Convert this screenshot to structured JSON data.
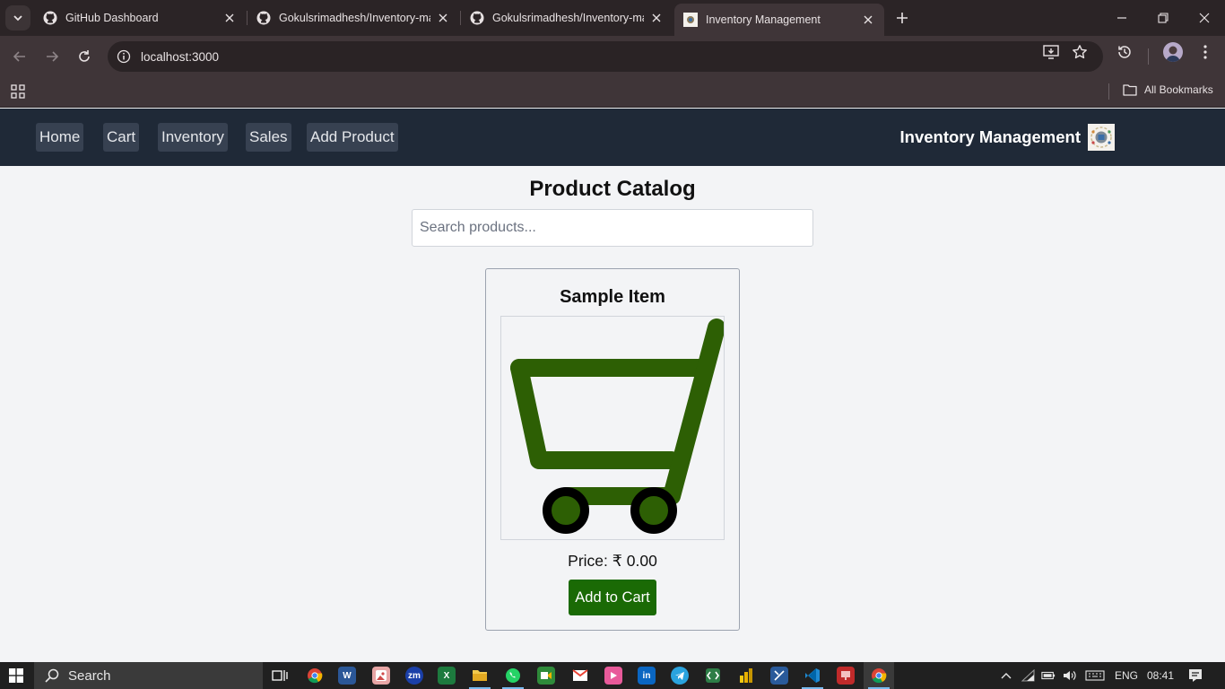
{
  "browser": {
    "tabs": [
      {
        "title": "GitHub Dashboard"
      },
      {
        "title": "Gokulsrimadhesh/Inventory-ma"
      },
      {
        "title": "Gokulsrimadhesh/Inventory-ma"
      },
      {
        "title": "Inventory Management"
      }
    ],
    "url": "localhost:3000",
    "all_bookmarks": "All Bookmarks"
  },
  "app": {
    "nav": [
      "Home",
      "Cart",
      "Inventory",
      "Sales",
      "Add Product"
    ],
    "brand": "Inventory Management"
  },
  "catalog": {
    "title": "Product Catalog",
    "search_placeholder": "Search products...",
    "product": {
      "name": "Sample Item",
      "price": "Price: ₹ 0.00",
      "button": "Add to Cart"
    }
  },
  "taskbar": {
    "search_label": "Search",
    "language": "ENG",
    "time": "08:41"
  }
}
